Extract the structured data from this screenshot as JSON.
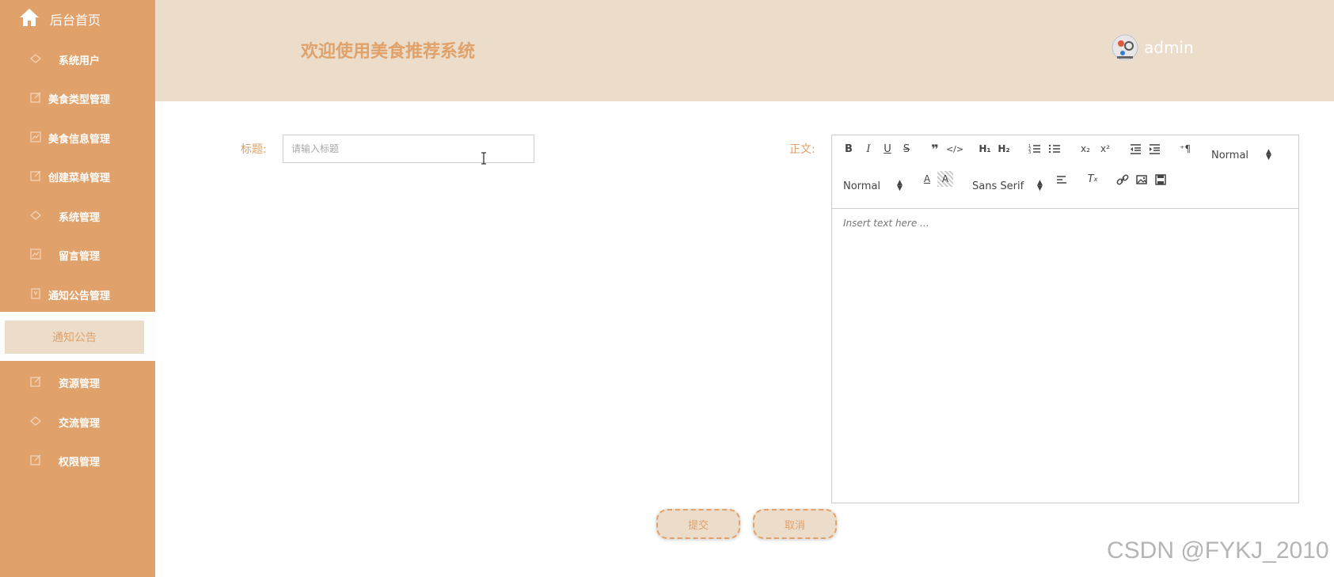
{
  "sidebar": {
    "home_label": "后台首页",
    "items": [
      {
        "label": "系统用户",
        "icon": "tag-icon"
      },
      {
        "label": "美食类型管理",
        "icon": "edit-icon"
      },
      {
        "label": "美食信息管理",
        "icon": "chart-icon"
      },
      {
        "label": "创建菜单管理",
        "icon": "edit-icon"
      },
      {
        "label": "系统管理",
        "icon": "tag-icon"
      },
      {
        "label": "留言管理",
        "icon": "chart-icon"
      },
      {
        "label": "通知公告管理",
        "icon": "bookmark-icon"
      },
      {
        "label": "资源管理",
        "icon": "edit-icon"
      },
      {
        "label": "交流管理",
        "icon": "tag-icon"
      },
      {
        "label": "权限管理",
        "icon": "edit-icon"
      }
    ],
    "active_sub_item": "通知公告"
  },
  "header": {
    "title": "欢迎使用美食推荐系统",
    "username": "admin"
  },
  "form": {
    "title_label": "标题:",
    "title_placeholder": "请输入标题",
    "title_value": "",
    "content_label": "正文:",
    "editor_placeholder": "Insert text here ...",
    "header_picker": "Normal",
    "size_picker": "Normal",
    "font_picker": "Sans Serif",
    "submit_label": "提交",
    "cancel_label": "取消"
  },
  "watermark": "CSDN @FYKJ_2010",
  "colors": {
    "sidebar_bg": "#e0a16a",
    "header_bg": "#ecdcca",
    "accent": "#e0a16a"
  }
}
